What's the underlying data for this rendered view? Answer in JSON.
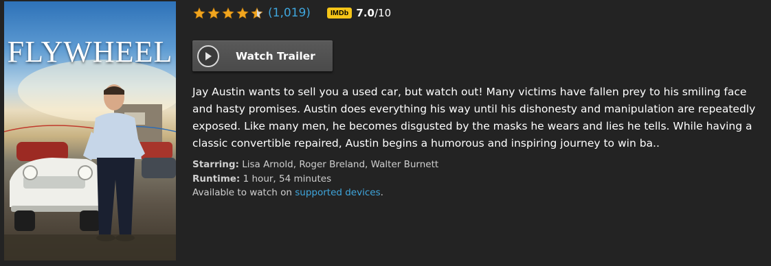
{
  "poster": {
    "title": "FLYWHEEL"
  },
  "rating": {
    "stars": 4.5,
    "review_count": "(1,019)"
  },
  "imdb": {
    "badge": "IMDb",
    "score": "7.0",
    "out_of": "/10"
  },
  "trailer": {
    "label": "Watch Trailer"
  },
  "synopsis": "Jay Austin wants to sell you a used car, but watch out! Many victims have fallen prey to his smiling face and hasty promises. Austin does everything his way until his dishonesty and manipulation are repeatedly exposed. Like many men, he becomes disgusted by the masks he wears and lies he tells. While having a classic convertible repaired, Austin begins a humorous and inspiring journey to win ba..",
  "details": {
    "starring_label": "Starring:",
    "starring_value": "Lisa Arnold, Roger Breland, Walter Burnett",
    "runtime_label": "Runtime:",
    "runtime_value": "1 hour, 54 minutes",
    "available_prefix": "Available to watch on",
    "available_link": "supported devices",
    "available_suffix": "."
  },
  "colors": {
    "background": "#232323",
    "link": "#3fa6dd",
    "star": "#f0a51f",
    "imdb_badge": "#f5c518"
  }
}
